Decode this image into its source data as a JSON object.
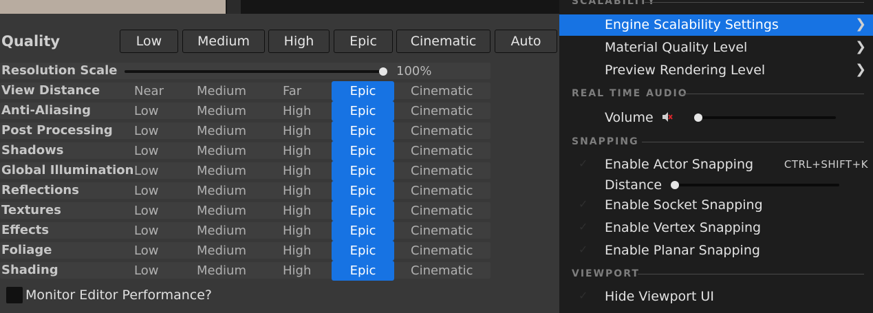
{
  "quality": {
    "title": "Quality",
    "presets": [
      "Low",
      "Medium",
      "High",
      "Epic",
      "Cinematic",
      "Auto"
    ]
  },
  "resolution": {
    "label": "Resolution Scale",
    "value": "100%",
    "level": 1.0
  },
  "settings": [
    {
      "label": "View Distance",
      "options": [
        "Near",
        "Medium",
        "Far",
        "Epic",
        "Cinematic"
      ],
      "selected": "Epic"
    },
    {
      "label": "Anti-Aliasing",
      "options": [
        "Low",
        "Medium",
        "High",
        "Epic",
        "Cinematic"
      ],
      "selected": "Epic"
    },
    {
      "label": "Post Processing",
      "options": [
        "Low",
        "Medium",
        "High",
        "Epic",
        "Cinematic"
      ],
      "selected": "Epic"
    },
    {
      "label": "Shadows",
      "options": [
        "Low",
        "Medium",
        "High",
        "Epic",
        "Cinematic"
      ],
      "selected": "Epic"
    },
    {
      "label": "Global Illumination",
      "options": [
        "Low",
        "Medium",
        "High",
        "Epic",
        "Cinematic"
      ],
      "selected": "Epic"
    },
    {
      "label": "Reflections",
      "options": [
        "Low",
        "Medium",
        "High",
        "Epic",
        "Cinematic"
      ],
      "selected": "Epic"
    },
    {
      "label": "Textures",
      "options": [
        "Low",
        "Medium",
        "High",
        "Epic",
        "Cinematic"
      ],
      "selected": "Epic"
    },
    {
      "label": "Effects",
      "options": [
        "Low",
        "Medium",
        "High",
        "Epic",
        "Cinematic"
      ],
      "selected": "Epic"
    },
    {
      "label": "Foliage",
      "options": [
        "Low",
        "Medium",
        "High",
        "Epic",
        "Cinematic"
      ],
      "selected": "Epic"
    },
    {
      "label": "Shading",
      "options": [
        "Low",
        "Medium",
        "High",
        "Epic",
        "Cinematic"
      ],
      "selected": "Epic"
    }
  ],
  "monitor": {
    "label": "Monitor Editor Performance?",
    "checked": false
  },
  "menu": {
    "scalability_header": "SCALABILITY",
    "engine_scalability": "Engine Scalability Settings",
    "material_quality": "Material Quality Level",
    "preview_rendering": "Preview Rendering Level",
    "audio_header": "REAL TIME AUDIO",
    "volume_label": "Volume",
    "volume_icon": "speaker-muted-icon",
    "volume_level": 0.0,
    "snapping_header": "SNAPPING",
    "actor_snapping": "Enable Actor Snapping",
    "actor_snapping_shortcut": "CTRL+SHIFT+K",
    "distance_label": "Distance",
    "distance_level": 0.0,
    "socket_snapping": "Enable Socket Snapping",
    "vertex_snapping": "Enable Vertex Snapping",
    "planar_snapping": "Enable Planar Snapping",
    "viewport_header": "VIEWPORT",
    "hide_viewport_ui": "Hide Viewport UI",
    "chevron_icon": "chevron-right-icon",
    "check_icon": "checkmark-icon"
  },
  "colors": {
    "selected_accent": "#1773e3",
    "panel_bg": "#383838",
    "menu_bg": "#1d1d1d"
  }
}
